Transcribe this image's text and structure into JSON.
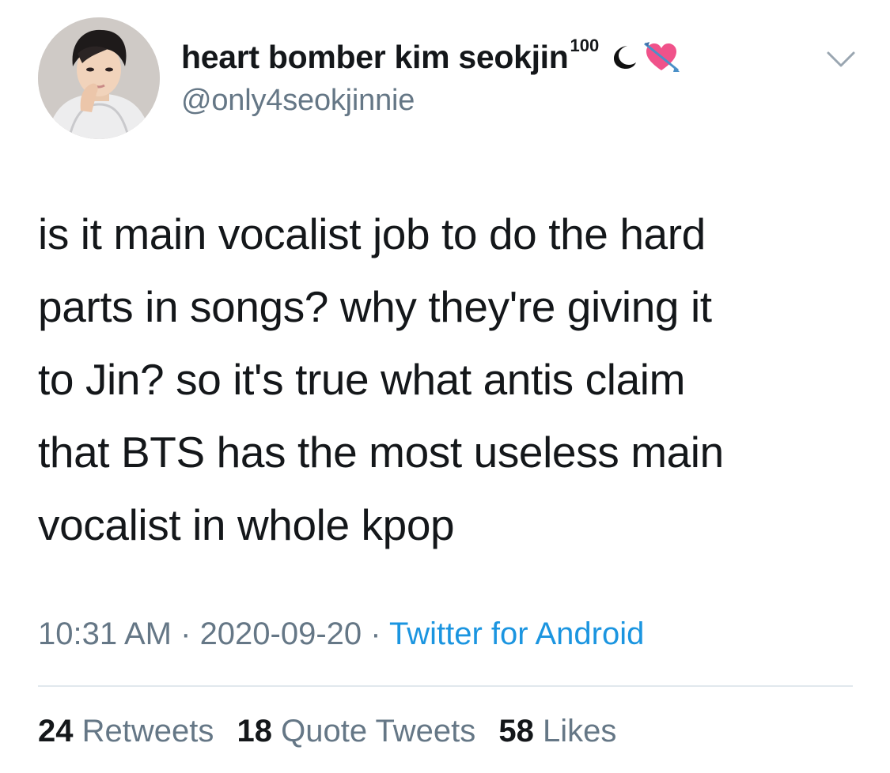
{
  "user": {
    "display_name": "heart bomber kim seokjin",
    "display_name_suffix": "100",
    "handle": "@only4seokjinnie",
    "avatar_icon": "profile-photo",
    "emoji_icons": [
      "crescent-moon-icon",
      "heart-with-arrow-icon"
    ]
  },
  "tweet": {
    "lines": [
      "is it main vocalist job to do the hard",
      "parts in songs? why they're giving it",
      "to Jin? so it's true what antis claim",
      "that BTS has the most useless main",
      "vocalist in whole kpop"
    ]
  },
  "meta": {
    "time": "10:31 AM",
    "separator": " · ",
    "date": "2020-09-20",
    "source": "Twitter for Android"
  },
  "stats": {
    "retweets_count": "24",
    "retweets_label": "Retweets",
    "quote_count": "18",
    "quote_label": "Quote Tweets",
    "likes_count": "58",
    "likes_label": "Likes"
  },
  "colors": {
    "text_primary": "#14171a",
    "text_secondary": "#657786",
    "link": "#1b95e0",
    "divider": "#e1e8ed",
    "heart_pink": "#f0528a"
  }
}
